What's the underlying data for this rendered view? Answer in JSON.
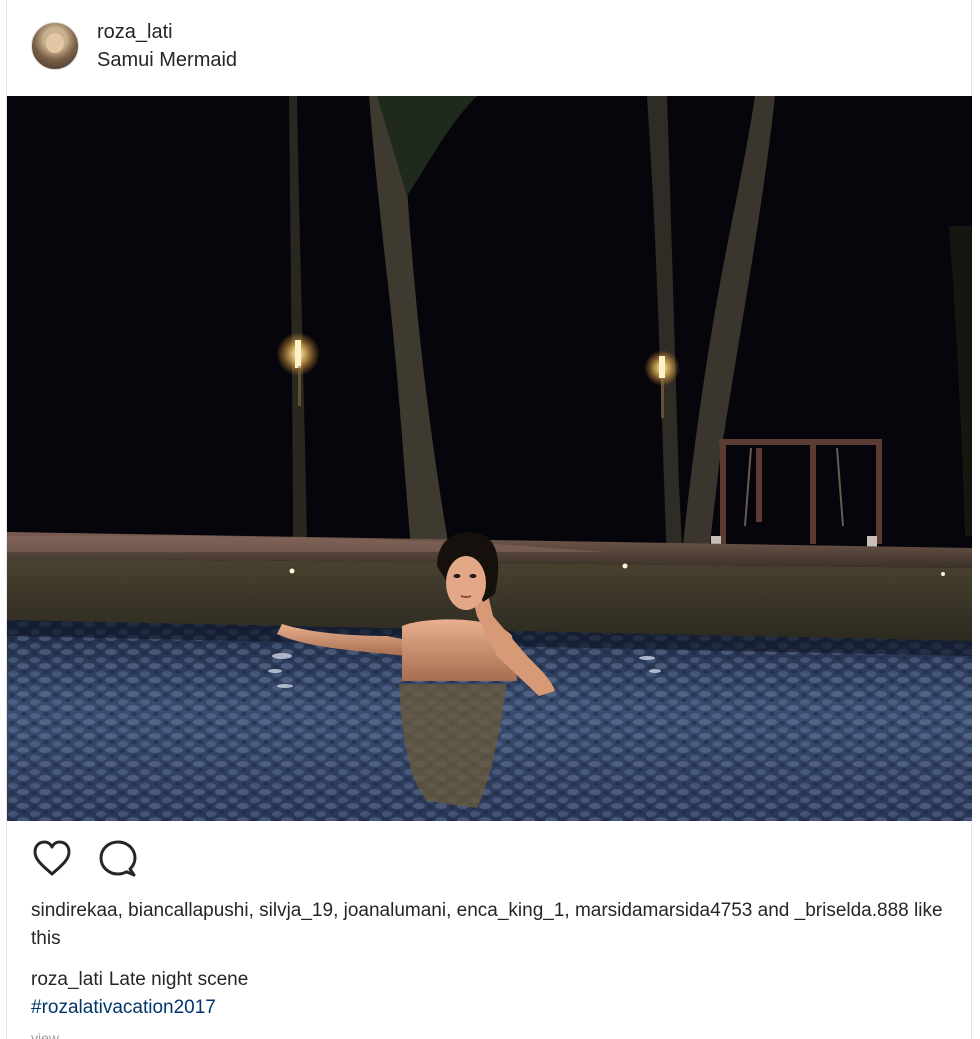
{
  "post": {
    "author": {
      "username": "roza_lati",
      "location": "Samui Mermaid"
    },
    "likes_text": "sindirekaa, biancallapushi, silvja_19, joanalumani, enca_king_1, marsidamarsida4753 and _briselda.888 like this",
    "caption": {
      "username": "roza_lati",
      "text": "Late night scene",
      "hashtag": "#rozalativacation2017"
    },
    "more_link": "view"
  },
  "icons": {
    "like": "heart-icon",
    "comment": "comment-bubble-icon"
  },
  "colors": {
    "text": "#262626",
    "hashtag": "#003569",
    "border": "#e6e6e6"
  }
}
